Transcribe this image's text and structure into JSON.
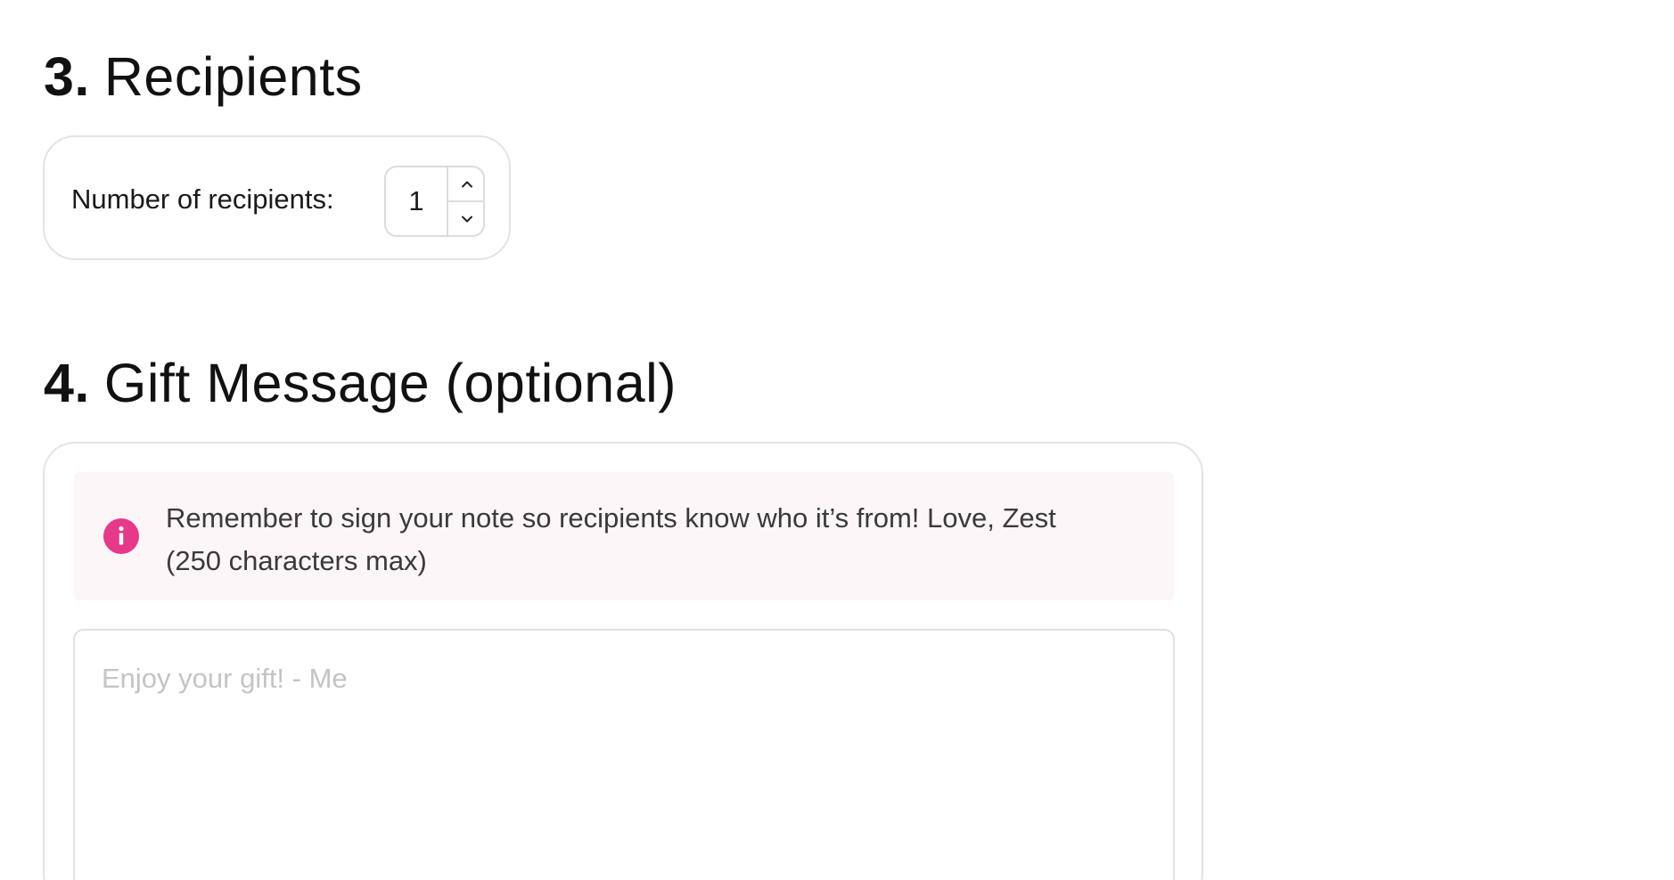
{
  "sections": {
    "recipients": {
      "number": "3.",
      "title": "Recipients",
      "label": "Number of recipients:",
      "value": "1"
    },
    "gift_message": {
      "number": "4.",
      "title": "Gift Message (optional)",
      "info_line1": "Remember to sign your note so recipients know who it’s from! Love, Zest",
      "info_line2": "(250 characters max)",
      "placeholder": "Enjoy your gift! - Me",
      "value": ""
    }
  },
  "colors": {
    "accent": "#e6398a",
    "banner_bg": "#fdf6f8",
    "border": "#e4e4e4",
    "placeholder": "#c4c4c4"
  },
  "icons": {
    "info": "info-icon",
    "stepper_up": "chevron-up-icon",
    "stepper_down": "chevron-down-icon"
  }
}
